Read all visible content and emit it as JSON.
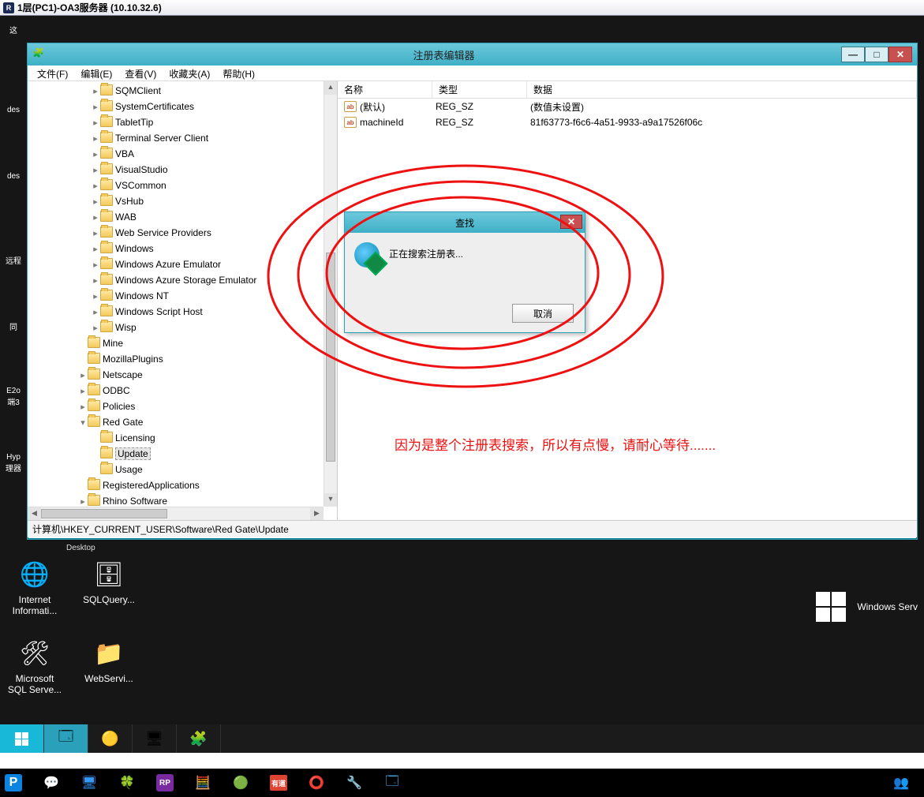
{
  "remote": {
    "title": "1层(PC1)-OA3服务器 (10.10.32.6)"
  },
  "leftDesk": [
    "这",
    "des",
    "des",
    "远程",
    "同",
    "E2o\n端3",
    "Hyp\n理器"
  ],
  "labelDesktop": "Desktop",
  "win": {
    "title": "注册表编辑器",
    "menu": [
      "文件(F)",
      "编辑(E)",
      "查看(V)",
      "收藏夹(A)",
      "帮助(H)"
    ],
    "btnMin": "—",
    "btnMax": "□",
    "btnClose": "✕",
    "status": "计算机\\HKEY_CURRENT_USER\\Software\\Red Gate\\Update"
  },
  "treeA": [
    "SQMClient",
    "SystemCertificates",
    "TabletTip",
    "Terminal Server Client",
    "VBA",
    "VisualStudio",
    "VSCommon",
    "VsHub",
    "WAB",
    "Web Service Providers",
    "Windows",
    "Windows Azure Emulator",
    "Windows Azure Storage Emulator",
    "Windows NT",
    "Windows Script Host",
    "Wisp"
  ],
  "treeB": [
    "Mine",
    "MozillaPlugins",
    "Netscape",
    "ODBC",
    "Policies"
  ],
  "treeRedGate": "Red Gate",
  "treeRedGateChildren": [
    "Licensing",
    "Update",
    "Usage"
  ],
  "treeSelected": "Update",
  "treeC": [
    "RegisteredApplications",
    "Rhino Software"
  ],
  "scrollArrows": {
    "up": "▲",
    "down": "▼",
    "left": "◀",
    "right": "▶"
  },
  "listHdr": {
    "name": "名称",
    "type": "类型",
    "data": "数据"
  },
  "listRows": [
    {
      "name": "(默认)",
      "type": "REG_SZ",
      "data": "(数值未设置)"
    },
    {
      "name": "machineId",
      "type": "REG_SZ",
      "data": "81f63773-f6c6-4a51-9933-a9a17526f06c"
    }
  ],
  "iconAb": "ab",
  "dlg": {
    "title": "查找",
    "msg": "正在搜索注册表...",
    "cancel": "取消",
    "close": "✕"
  },
  "annoText": "因为是整个注册表搜索，所以有点慢，请耐心等待.......",
  "lowerIcons1": [
    {
      "label": "Internet\nInformati...",
      "glyph": "🌐"
    },
    {
      "label": "SQLQuery...",
      "glyph": "🗄"
    }
  ],
  "lowerIcons2": [
    {
      "label": "Microsoft\nSQL Serve...",
      "glyph": "🛠"
    },
    {
      "label": "WebServi...",
      "glyph": "📁"
    }
  ],
  "brand": "Windows Serv",
  "hostTb": {
    "p": "P",
    "rp": "RP",
    "yd": "有道",
    "ppl": "👥"
  }
}
